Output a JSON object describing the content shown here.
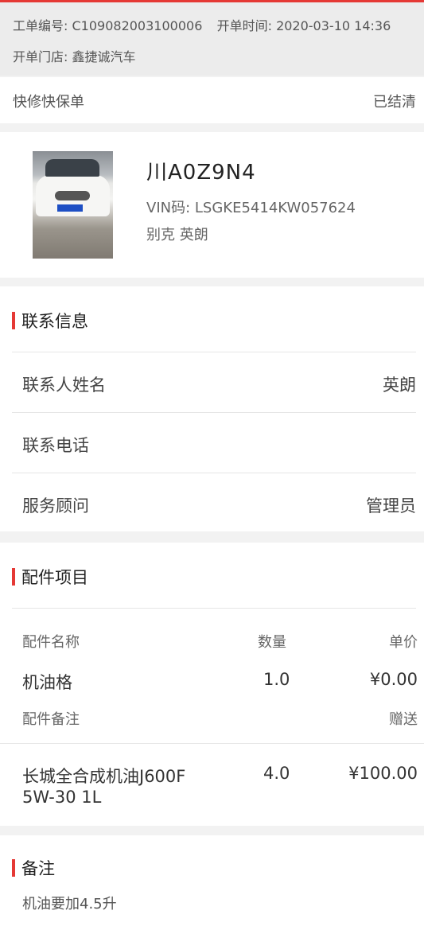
{
  "colors": {
    "accent": "#e53935",
    "background": "#f2f2f2",
    "card": "#ffffff"
  },
  "order": {
    "number_label": "工单编号:",
    "number_value": "C109082003100006",
    "time_label": "开单时间:",
    "time_value": "2020-03-10 14:36",
    "store_label": "开单门店:",
    "store_value": "鑫捷诚汽车"
  },
  "order_type": {
    "label": "快修快保单",
    "status": "已结清"
  },
  "vehicle": {
    "plate": "川A0Z9N4",
    "vin_label": "VIN码:",
    "vin_value": "LSGKE5414KW057624",
    "model": "别克 英朗"
  },
  "contact": {
    "title": "联系信息",
    "rows": [
      {
        "label": "联系人姓名",
        "value": "英朗"
      },
      {
        "label": "联系电话",
        "value": ""
      },
      {
        "label": "服务顾问",
        "value": "管理员"
      }
    ]
  },
  "parts": {
    "title": "配件项目",
    "headers": {
      "name": "配件名称",
      "qty": "数量",
      "price": "单价"
    },
    "items": [
      {
        "name": "机油格",
        "qty": "1.0",
        "price": "¥0.00",
        "note_label": "配件备注",
        "note_value": "赠送"
      },
      {
        "name_line1": "长城全合成机油J600F",
        "name_line2": "5W-30 1L",
        "qty": "4.0",
        "price": "¥100.00"
      }
    ]
  },
  "remarks": {
    "title": "备注",
    "text": "机油要加4.5升"
  }
}
